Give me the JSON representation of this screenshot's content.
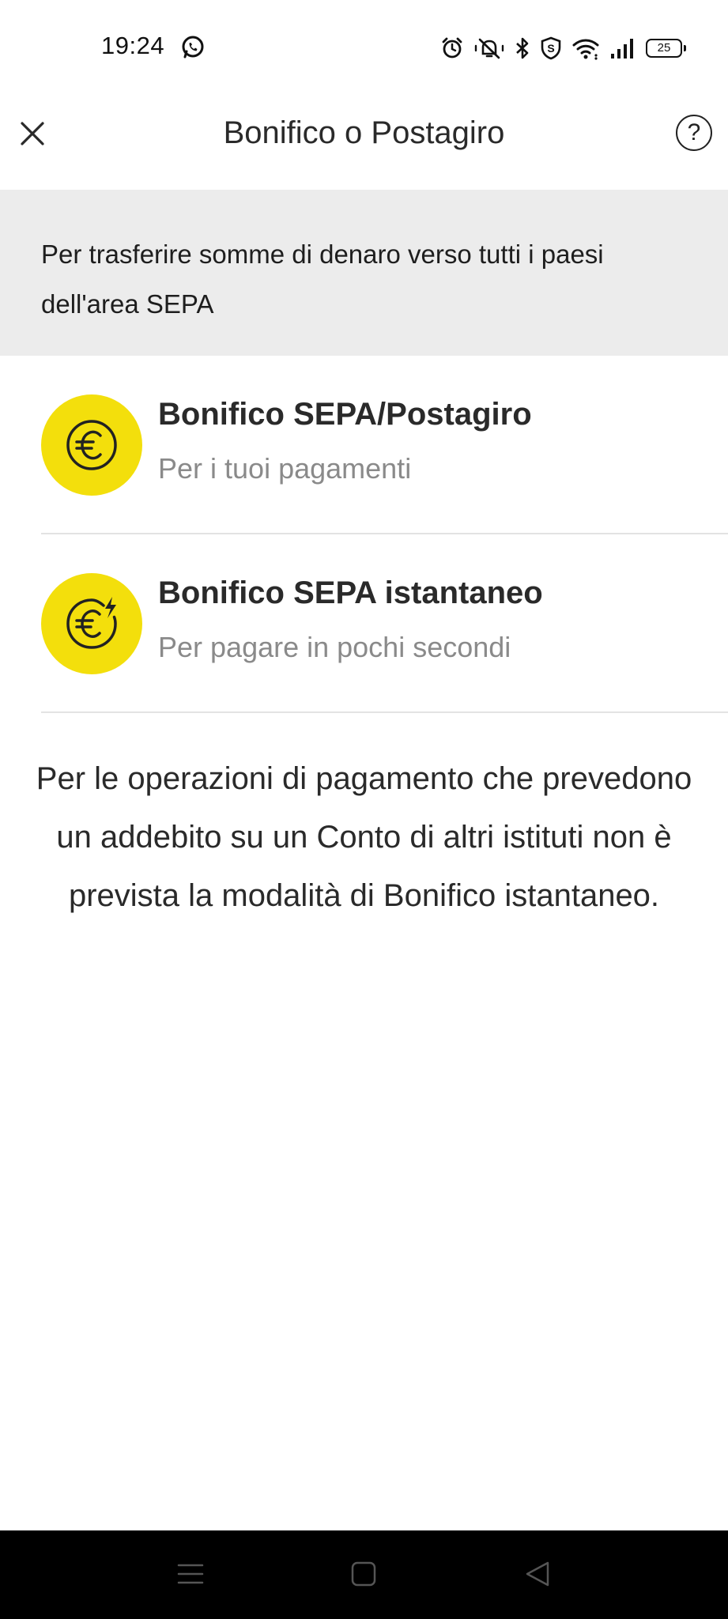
{
  "status_bar": {
    "time": "19:24",
    "battery_level": "25",
    "icons": [
      "whatsapp-icon",
      "alarm-icon",
      "mute-icon",
      "bluetooth-icon",
      "shield-icon",
      "wifi-icon",
      "signal-icon",
      "battery-icon"
    ]
  },
  "header": {
    "title": "Bonifico o Postagiro",
    "help_label": "?"
  },
  "banner": {
    "text": "Per trasferire somme di denaro verso tutti i paesi dell'area SEPA"
  },
  "options": [
    {
      "title": "Bonifico SEPA/Postagiro",
      "subtitle": "Per i tuoi pagamenti",
      "icon": "euro-coin-icon"
    },
    {
      "title": "Bonifico SEPA istantaneo",
      "subtitle": "Per pagare in pochi secondi",
      "icon": "euro-instant-icon"
    }
  ],
  "notice": {
    "text": "Per le operazioni di pagamento che prevedono un addebito su un Conto di altri istituti non è prevista la modalità di Bonifico istantaneo."
  },
  "navigation": {
    "buttons": [
      "menu-icon",
      "home-icon",
      "back-icon"
    ]
  },
  "colors": {
    "accent_yellow": "#f3df0c",
    "banner_bg": "#ececec",
    "nav_bg": "#000000"
  }
}
